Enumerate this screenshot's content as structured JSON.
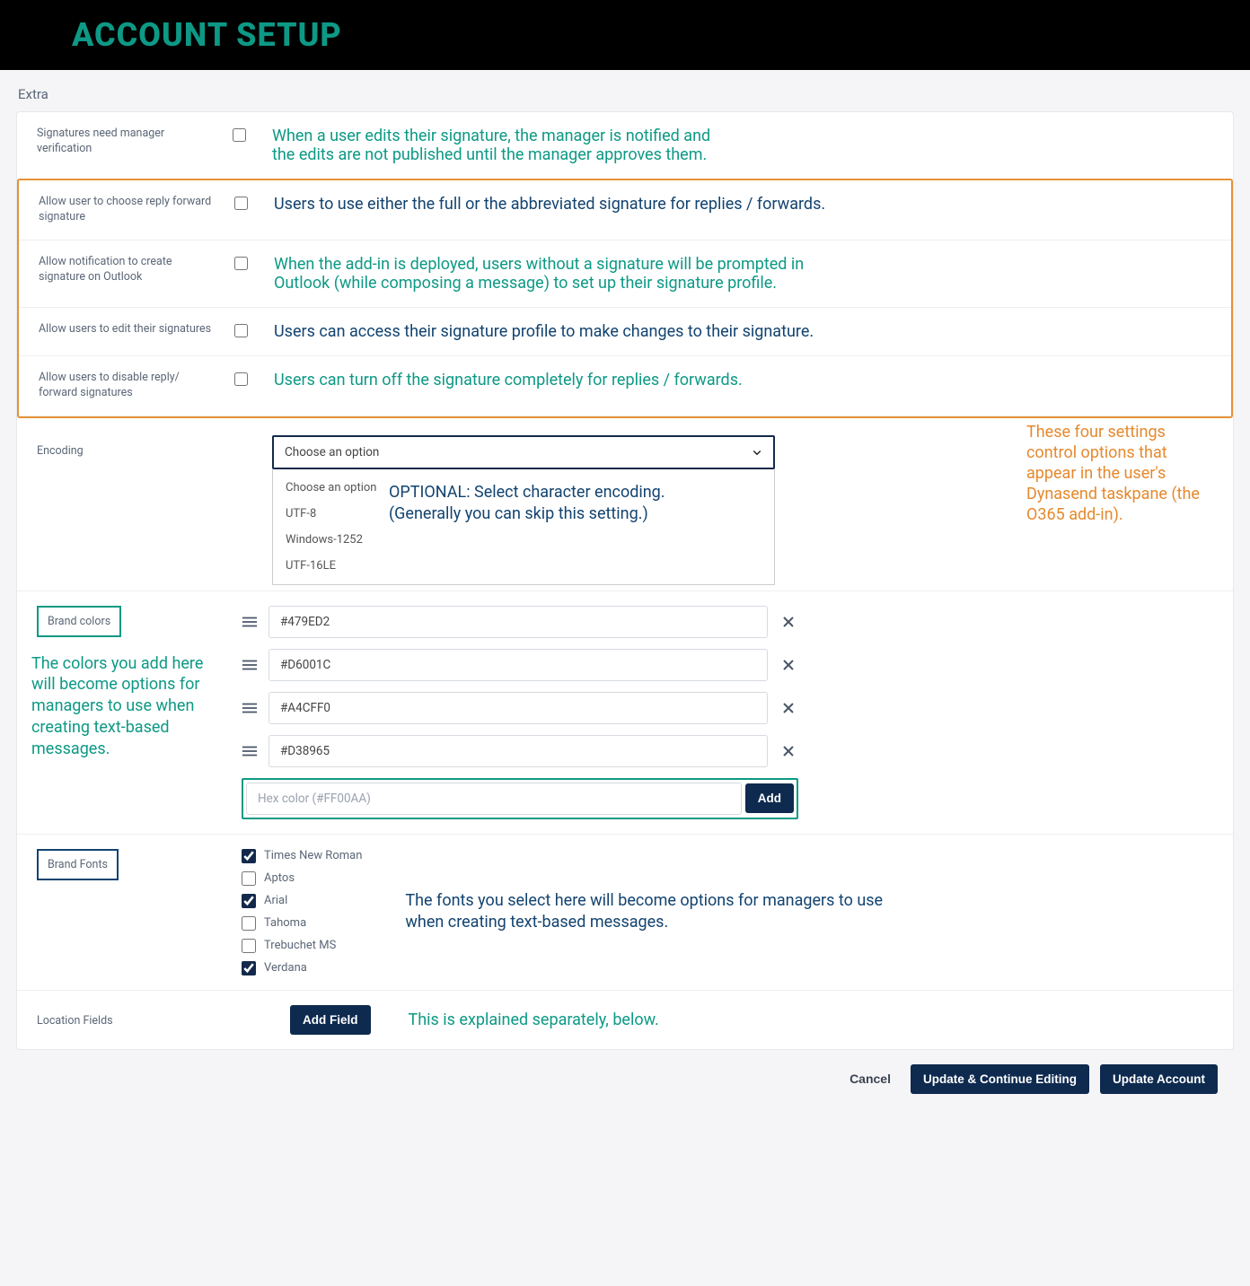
{
  "header": {
    "title": "ACCOUNT SETUP"
  },
  "section": {
    "label": "Extra"
  },
  "settings": {
    "sig_verify": {
      "label": "Signatures need manager verification",
      "desc1": "When a user edits their signature, the manager is notified and",
      "desc2": "the edits are not published until the manager approves them."
    },
    "reply_sig": {
      "label": "Allow user to choose reply forward signature",
      "desc": "Users to use either the full or the abbreviated signature for replies / forwards."
    },
    "outlook_notify": {
      "label": "Allow notification to create signature on Outlook",
      "desc1": "When the add-in is deployed, users without a signature will be prompted in",
      "desc2": "Outlook (while composing a message) to set up their signature profile."
    },
    "edit_sig": {
      "label": "Allow users to edit their signatures",
      "desc": "Users can access their signature profile to make changes to their signature."
    },
    "disable_reply": {
      "label": "Allow users to disable reply/ forward signatures",
      "desc": "Users can turn off the signature completely for replies / forwards."
    }
  },
  "orange_callout": "These four settings control options that appear in the user's Dynasend taskpane (the O365 add-in).",
  "encoding": {
    "label": "Encoding",
    "selected": "Choose an option",
    "options": [
      "Choose an option",
      "UTF-8",
      "Windows-1252",
      "UTF-16LE"
    ],
    "help1": "OPTIONAL: Select character encoding.",
    "help2": "(Generally you can skip this setting.)"
  },
  "brand_colors": {
    "label": "Brand colors",
    "help": "The colors you add here will become options for managers to use when creating text-based messages.",
    "items": [
      "#479ED2",
      "#D6001C",
      "#A4CFF0",
      "#D38965"
    ],
    "placeholder": "Hex color (#FF00AA)",
    "add_label": "Add"
  },
  "brand_fonts": {
    "label": "Brand Fonts",
    "help": "The fonts you select here will become options for managers to use when creating text-based messages.",
    "items": [
      {
        "name": "Times New Roman",
        "checked": true
      },
      {
        "name": "Aptos",
        "checked": false
      },
      {
        "name": "Arial",
        "checked": true
      },
      {
        "name": "Tahoma",
        "checked": false
      },
      {
        "name": "Trebuchet MS",
        "checked": false
      },
      {
        "name": "Verdana",
        "checked": true
      }
    ]
  },
  "location": {
    "label": "Location Fields",
    "button": "Add Field",
    "help": "This is explained separately, below."
  },
  "footer": {
    "cancel": "Cancel",
    "update_continue": "Update & Continue Editing",
    "update": "Update Account"
  }
}
